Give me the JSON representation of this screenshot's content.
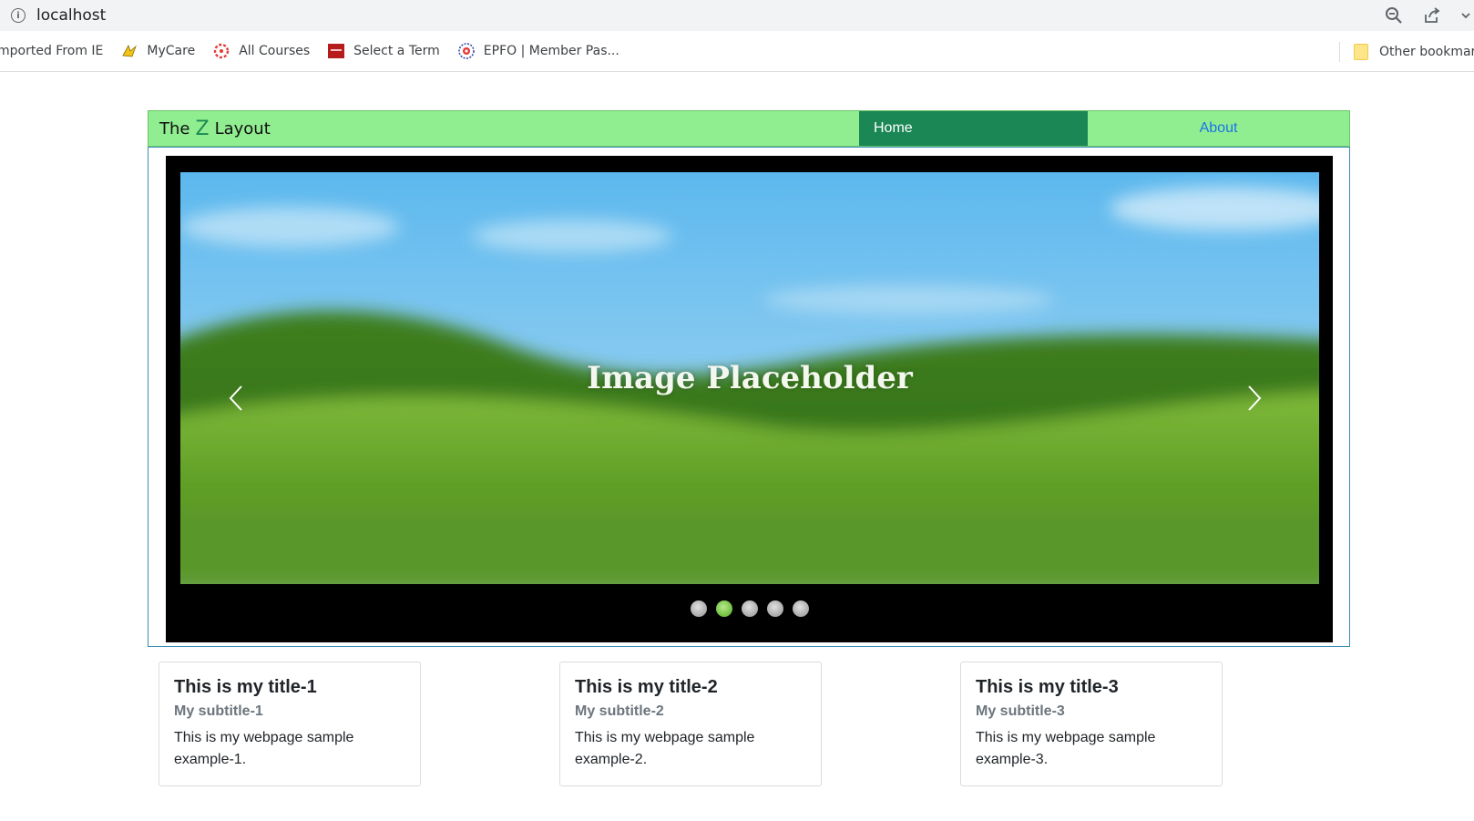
{
  "browser": {
    "url": "localhost",
    "bookmarks": [
      {
        "label": "mported From IE",
        "icon": "none"
      },
      {
        "label": "MyCare",
        "icon": "mycare-icon"
      },
      {
        "label": "All Courses",
        "icon": "courses-icon"
      },
      {
        "label": "Select a Term",
        "icon": "term-icon"
      },
      {
        "label": "EPFO | Member Pas...",
        "icon": "epfo-icon"
      }
    ],
    "other_bookmarks": "Other bookmar"
  },
  "header": {
    "brand_prefix": "The",
    "brand_z": "Z",
    "brand_suffix": "Layout",
    "nav": [
      {
        "label": "Home",
        "active": true
      },
      {
        "label": "About",
        "active": false
      }
    ]
  },
  "carousel": {
    "placeholder_text": "Image Placeholder",
    "slide_count": 5,
    "active_index": 1
  },
  "cards": [
    {
      "title": "This is my title-1",
      "subtitle": "My subtitle-1",
      "text": "This is my webpage sample example-1."
    },
    {
      "title": "This is my title-2",
      "subtitle": "My subtitle-2",
      "text": "This is my webpage sample example-2."
    },
    {
      "title": "This is my title-3",
      "subtitle": "My subtitle-3",
      "text": "This is my webpage sample example-3."
    }
  ],
  "colors": {
    "header_bg": "#90ee90",
    "nav_active_bg": "#1b8755",
    "link": "#1a73e8",
    "dot_active": "#6fbf3c"
  }
}
